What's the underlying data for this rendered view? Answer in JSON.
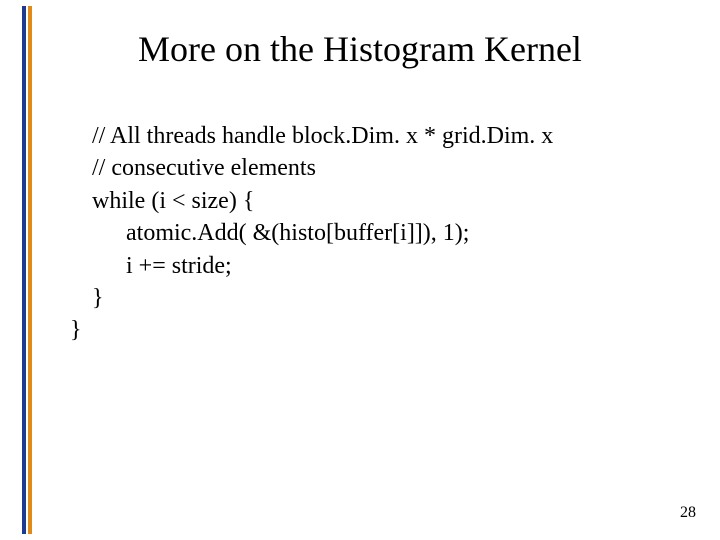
{
  "title": "More on the Histogram Kernel",
  "code": {
    "l1": "// All threads handle block.Dim. x * grid.Dim. x",
    "l2": "// consecutive elements",
    "l3": "while (i < size) {",
    "l4": "atomic.Add( &(histo[buffer[i]]), 1);",
    "l5": "i += stride;",
    "l6": "}",
    "l7": "}"
  },
  "page_number": "28"
}
